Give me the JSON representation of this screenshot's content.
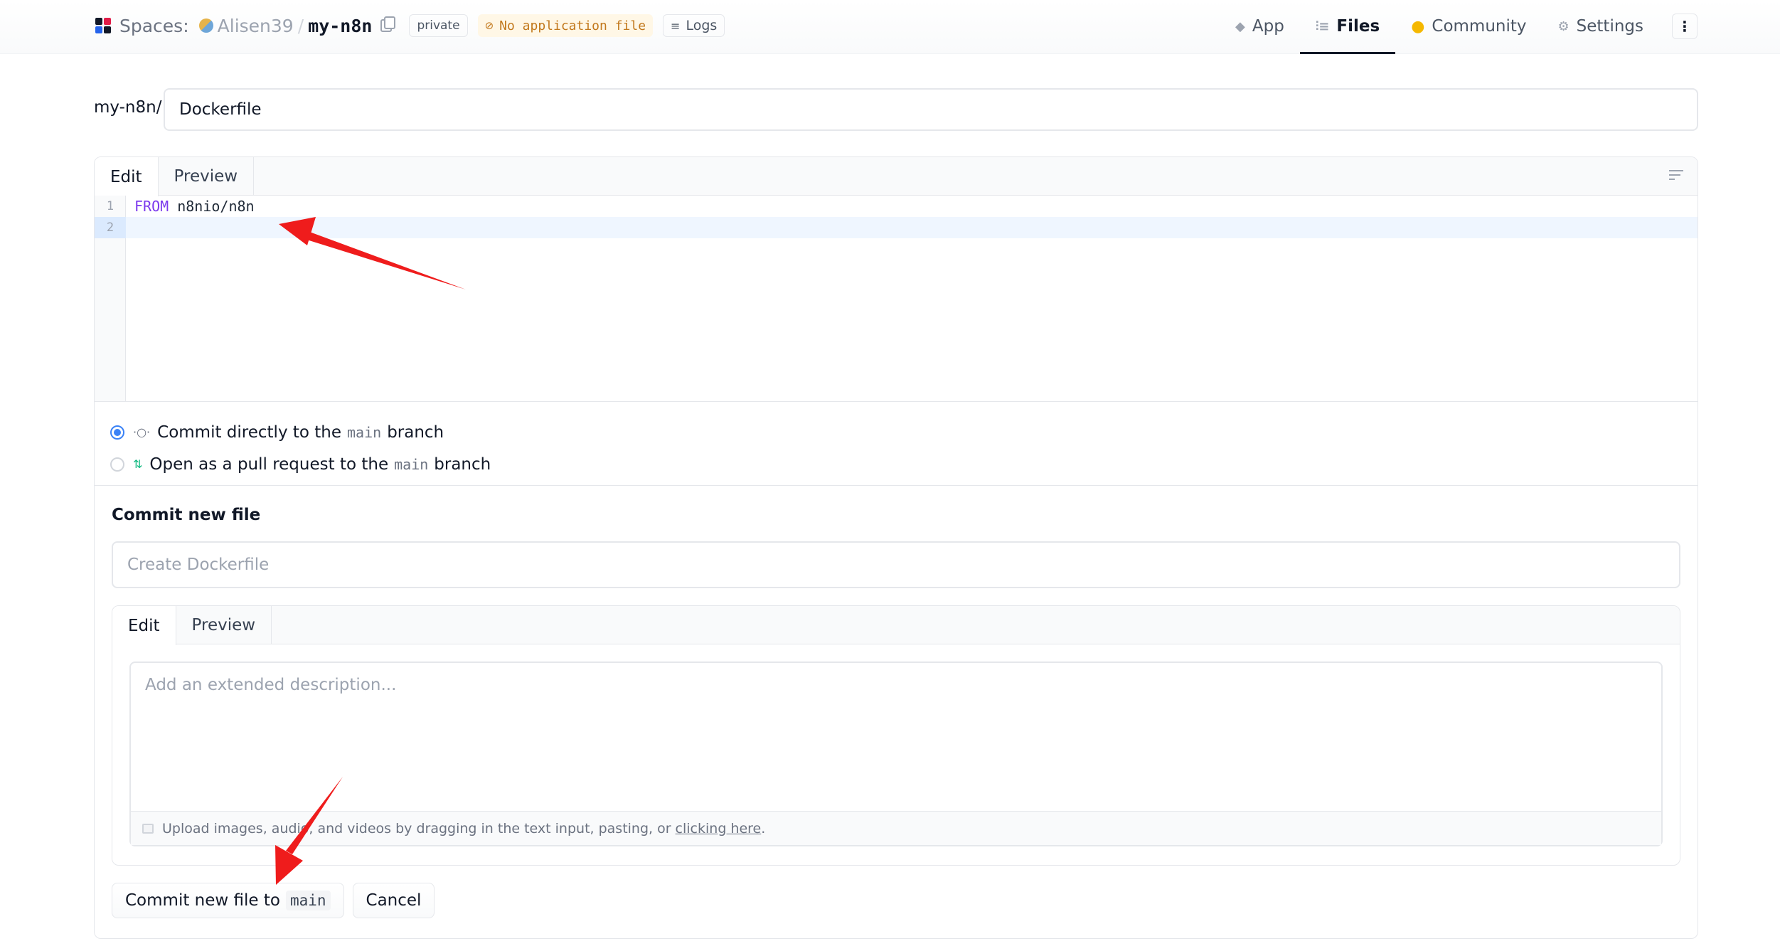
{
  "header": {
    "spaces_label": "Spaces:",
    "owner": "Alisen39",
    "separator": "/",
    "repo_name": "my-n8n",
    "visibility_badge": "private",
    "status_badge": "No application file",
    "logs_label": "Logs",
    "nav": [
      {
        "label": "App",
        "icon": "cube-icon"
      },
      {
        "label": "Files",
        "icon": "files-icon",
        "active": true
      },
      {
        "label": "Community",
        "icon": "community-icon"
      },
      {
        "label": "Settings",
        "icon": "gear-icon"
      }
    ],
    "more_icon": "⋮"
  },
  "path": {
    "prefix": "my-n8n/",
    "filename": "Dockerfile"
  },
  "editor": {
    "tabs": [
      "Edit",
      "Preview"
    ],
    "lines": [
      {
        "number": "1",
        "keyword": "FROM",
        "rest": " n8nio/n8n"
      },
      {
        "number": "2",
        "keyword": "",
        "rest": ""
      }
    ]
  },
  "branch_options": [
    {
      "text_before": "Commit directly to the",
      "branch": "main",
      "text_after": "branch",
      "checked": true
    },
    {
      "text_before": "Open as a pull request to the",
      "branch": "main",
      "text_after": "branch",
      "checked": false
    }
  ],
  "commit": {
    "title": "Commit new file",
    "summary_placeholder": "Create Dockerfile",
    "desc_tabs": [
      "Edit",
      "Preview"
    ],
    "description_placeholder": "Add an extended description...",
    "upload_hint": "Upload images, audio, and videos by dragging in the text input, pasting, or",
    "upload_link": "clicking here",
    "upload_end": ".",
    "submit_label": "Commit new file to",
    "submit_branch": "main",
    "cancel_label": "Cancel"
  },
  "colors": {
    "accent_blue": "#3b82f6",
    "warning_text": "#c2781c",
    "annotation_red": "#ef1c1c"
  }
}
